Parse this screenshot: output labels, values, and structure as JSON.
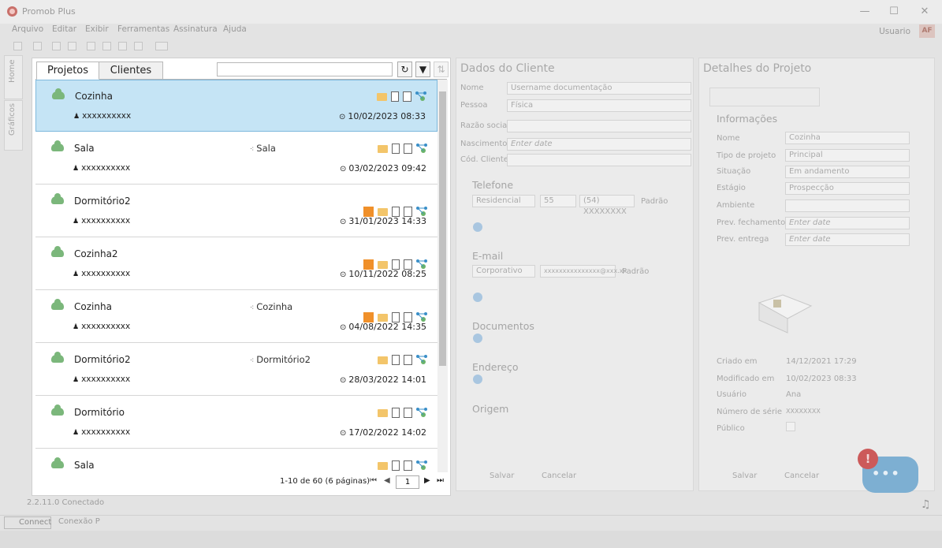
{
  "window": {
    "title": "Promob Plus",
    "minimize": "—",
    "maximize": "☐",
    "close": "✕"
  },
  "menu": [
    "Arquivo",
    "Editar",
    "Exibir",
    "Ferramentas",
    "Assinatura",
    "Ajuda"
  ],
  "user": {
    "label": "Usuario",
    "badge": "AF"
  },
  "side_tabs": [
    "Home",
    "Gráficos"
  ],
  "projects_panel": {
    "tabs": [
      "Projetos",
      "Clientes"
    ],
    "search_placeholder": "",
    "refresh_icon": "↻",
    "filter_icon": "▼",
    "sort_icon": "⇅",
    "rows": [
      {
        "name": "Cozinha",
        "room": "",
        "user": "xxxxxxxxxx",
        "date": "10/02/2023 08:33",
        "selected": true,
        "orange": false
      },
      {
        "name": "Sala",
        "room": "Sala",
        "user": "xxxxxxxxxx",
        "date": "03/02/2023 09:42",
        "selected": false,
        "orange": false
      },
      {
        "name": "Dormitório2",
        "room": "",
        "user": "xxxxxxxxxx",
        "date": "31/01/2023 14:33",
        "selected": false,
        "orange": true
      },
      {
        "name": "Cozinha2",
        "room": "",
        "user": "xxxxxxxxxx",
        "date": "10/11/2022 08:25",
        "selected": false,
        "orange": true
      },
      {
        "name": "Cozinha",
        "room": "Cozinha",
        "user": "xxxxxxxxxx",
        "date": "04/08/2022 14:35",
        "selected": false,
        "orange": true
      },
      {
        "name": "Dormitório2",
        "room": "Dormitório2",
        "user": "xxxxxxxxxx",
        "date": "28/03/2022 14:01",
        "selected": false,
        "orange": false
      },
      {
        "name": "Dormitório",
        "room": "",
        "user": "xxxxxxxxxx",
        "date": "17/02/2022 14:02",
        "selected": false,
        "orange": false
      },
      {
        "name": "Sala",
        "room": "",
        "user": "",
        "date": "",
        "selected": false,
        "orange": false
      }
    ],
    "pagination": {
      "label": "1-10 de 60 (6 páginas)",
      "current_page": "1"
    }
  },
  "client_panel": {
    "title": "Dados do Cliente",
    "fields": [
      {
        "label": "Nome",
        "value": "Username documentação"
      },
      {
        "label": "Pessoa",
        "value": "Física"
      },
      {
        "label": "Razão social",
        "value": ""
      },
      {
        "label": "Nascimento",
        "value": "Enter date"
      },
      {
        "label": "Cód. Cliente",
        "value": ""
      }
    ],
    "phone": {
      "title": "Telefone",
      "type": "Residencial",
      "code": "55",
      "number": "(54) XXXXXXXX",
      "default_label": "Padrão"
    },
    "email": {
      "title": "E-mail",
      "type": "Corporativo",
      "address": "xxxxxxxxxxxxxxx@xxx.xx",
      "default_label": "Padrão"
    },
    "documents_title": "Documentos",
    "address_title": "Endereço",
    "origin_title": "Origem",
    "save": "Salvar",
    "cancel": "Cancelar"
  },
  "project_details": {
    "title": "Detalhes do Projeto",
    "section": "Informações",
    "fields": [
      {
        "label": "Nome",
        "value": "Cozinha"
      },
      {
        "label": "Tipo de projeto",
        "value": "Principal"
      },
      {
        "label": "Situação",
        "value": "Em andamento"
      },
      {
        "label": "Estágio",
        "value": "Prospecção"
      },
      {
        "label": "Ambiente",
        "value": ""
      },
      {
        "label": "Prev. fechamento",
        "value": "Enter date"
      },
      {
        "label": "Prev. entrega",
        "value": "Enter date"
      }
    ],
    "meta": [
      {
        "label": "Criado em",
        "value": "14/12/2021 17:29"
      },
      {
        "label": "Modificado em",
        "value": "10/02/2023 08:33"
      },
      {
        "label": "Usuário",
        "value": "Ana"
      },
      {
        "label": "Número de série",
        "value": "XXXXXXXX"
      },
      {
        "label": "Público",
        "value": ""
      }
    ],
    "save": "Salvar",
    "cancel": "Cancelar"
  },
  "status": {
    "version": "2.2.11.0 Conectado",
    "connect": "Connect",
    "conexao": "Conexão P"
  },
  "chat": {
    "alert": "!",
    "dots": "•••"
  }
}
